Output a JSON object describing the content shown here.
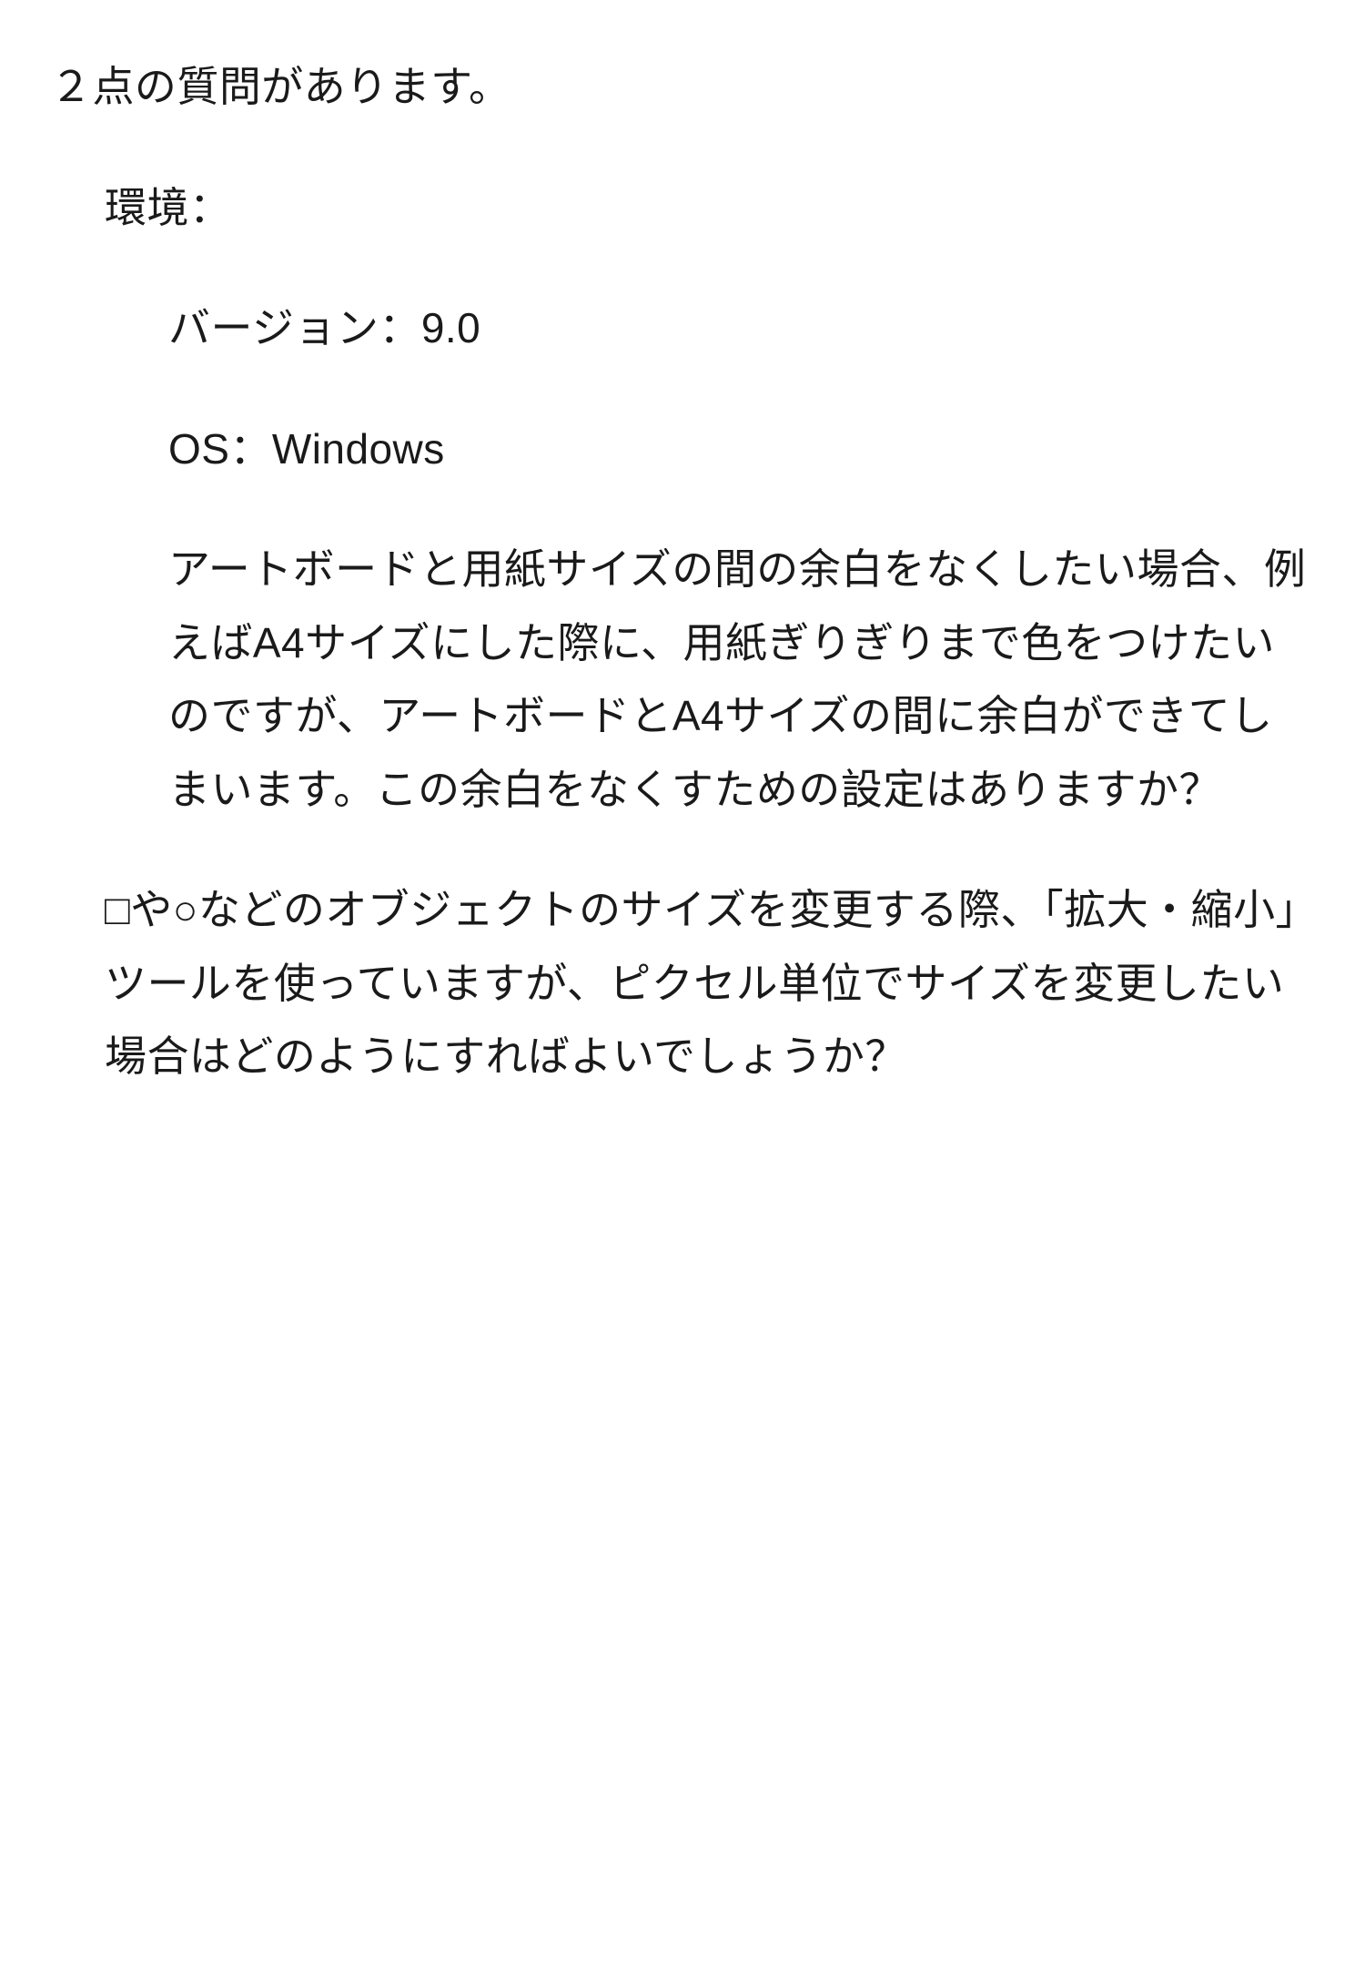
{
  "intro": "２点の質問があります。",
  "env": {
    "label": "環境：",
    "version": "バージョン：9.0",
    "os": "OS：Windows"
  },
  "questions": {
    "q1": "アートボードと用紙サイズの間の余白をなくしたい場合、例えばA4サイズにした際に、用紙ぎりぎりまで色をつけたいのですが、アートボードとA4サイズの間に余白ができてしまいます。この余白をなくすための設定はありますか？",
    "q2": "□や○などのオブジェクトのサイズを変更する際、「拡大・縮小」ツールを使っていますが、ピクセル単位でサイズを変更したい場合はどのようにすればよいでしょうか？"
  }
}
